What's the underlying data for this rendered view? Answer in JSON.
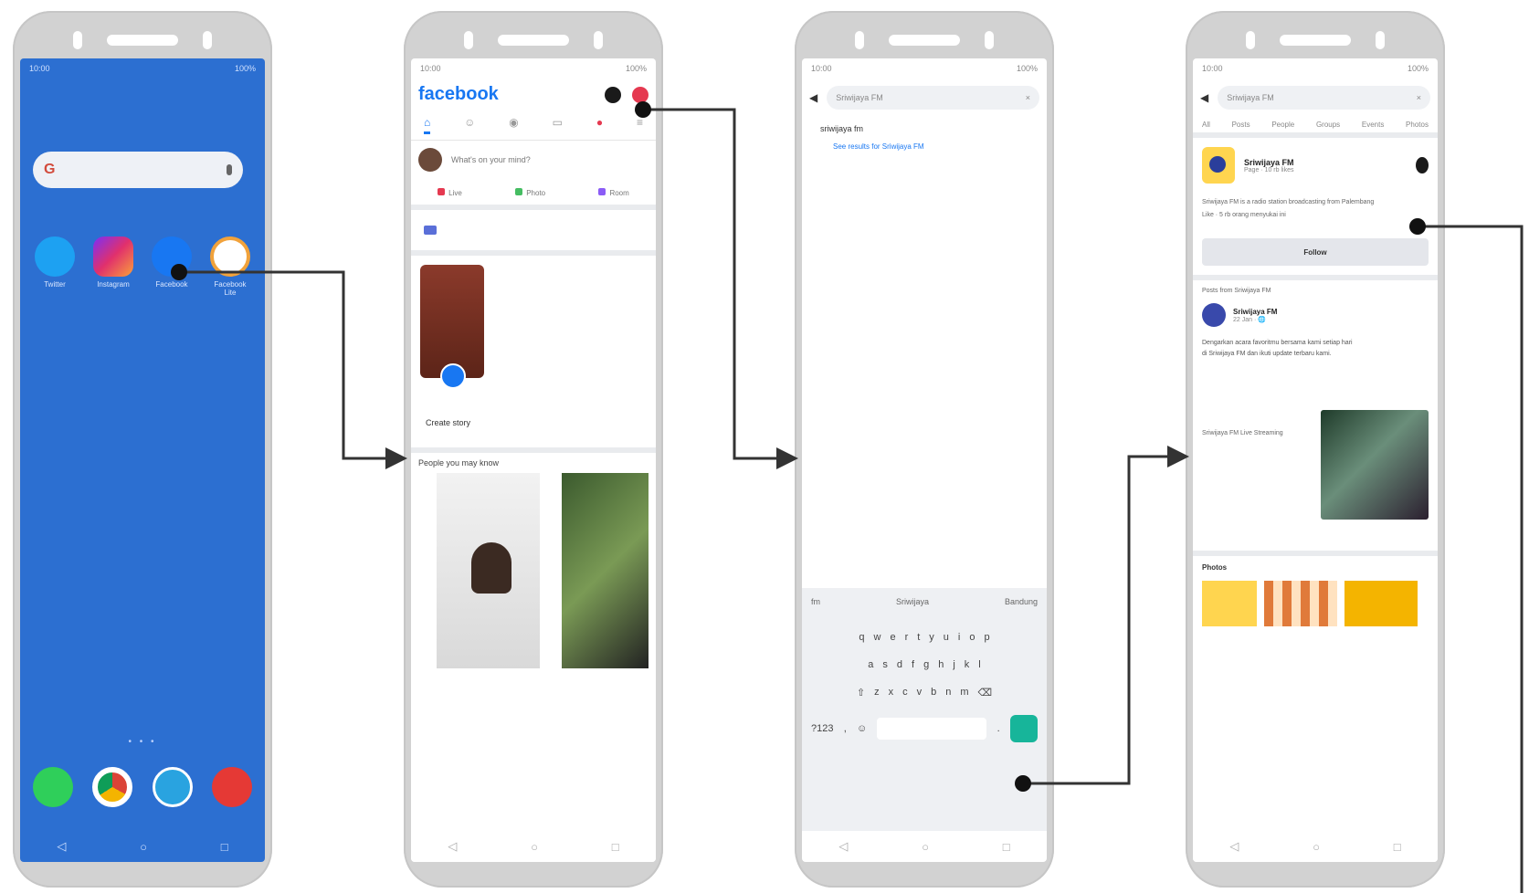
{
  "home": {
    "status_time": "10:00",
    "status_right": "100%",
    "search_logo": "G",
    "apps": [
      {
        "label": "Twitter",
        "color": "#1da1f2",
        "icon": "bird-icon"
      },
      {
        "label": "Instagram",
        "color": "#e1306c",
        "icon": "camera-icon"
      },
      {
        "label": "Facebook",
        "color": "#1877f2",
        "icon": "facebook-icon"
      },
      {
        "label": "Facebook Lite",
        "color": "#ffffff",
        "icon": "facebook-lite-icon"
      }
    ],
    "dock": [
      {
        "icon": "phone-icon",
        "color": "#2fcf5a"
      },
      {
        "icon": "chrome-icon",
        "color": "#ffffff"
      },
      {
        "icon": "telegram-icon",
        "color": "#29a3e0"
      },
      {
        "icon": "camera-app-icon",
        "color": "#e53935"
      }
    ],
    "page_dots": "• • •"
  },
  "facebook": {
    "status_time": "10:00",
    "status_right": "100%",
    "logo": "facebook",
    "composer_text": "What's on your mind?",
    "actions": [
      "Live",
      "Photo",
      "Room"
    ],
    "story_label": "Create story",
    "pymk_title": "People you may know"
  },
  "search": {
    "status_time": "10:00",
    "status_right": "100%",
    "query": "Sriwijaya FM",
    "suggestion": "sriwijaya fm",
    "suggestion_link": "See results for Sriwijaya FM",
    "kb_suggestions": [
      "fm",
      "Sriwijaya",
      "Bandung"
    ],
    "kb_rows": [
      [
        "q",
        "w",
        "e",
        "r",
        "t",
        "y",
        "u",
        "i",
        "o",
        "p"
      ],
      [
        "a",
        "s",
        "d",
        "f",
        "g",
        "h",
        "j",
        "k",
        "l"
      ],
      [
        "⇧",
        "z",
        "x",
        "c",
        "v",
        "b",
        "n",
        "m",
        "⌫"
      ]
    ],
    "kb_bottom": [
      "?123",
      ",",
      "☺",
      ".",
      "⏎"
    ]
  },
  "results": {
    "status_time": "10:00",
    "status_right": "100%",
    "query": "Sriwijaya FM",
    "tabs": [
      "All",
      "Posts",
      "People",
      "Groups",
      "Events",
      "Photos"
    ],
    "page_name": "Sriwijaya FM",
    "page_sub": "Page · 10 rb likes",
    "page_lines": [
      "Sriwijaya FM is a radio station broadcasting from Palembang",
      "Like · 5 rb orang menyukai ini"
    ],
    "follow_label": "Follow",
    "post_head": "Posts from Sriwijaya FM",
    "post_author": "Sriwijaya FM",
    "post_meta": "22 Jan · 🌐",
    "post_body": [
      "Dengarkan acara favoritmu bersama kami setiap hari",
      "di Sriwijaya FM dan ikuti update terbaru kami."
    ],
    "post_media_text": "Sriwijaya FM Live Streaming",
    "photos_title": "Photos"
  },
  "nav": {
    "back": "◁",
    "home": "○",
    "recent": "□"
  }
}
